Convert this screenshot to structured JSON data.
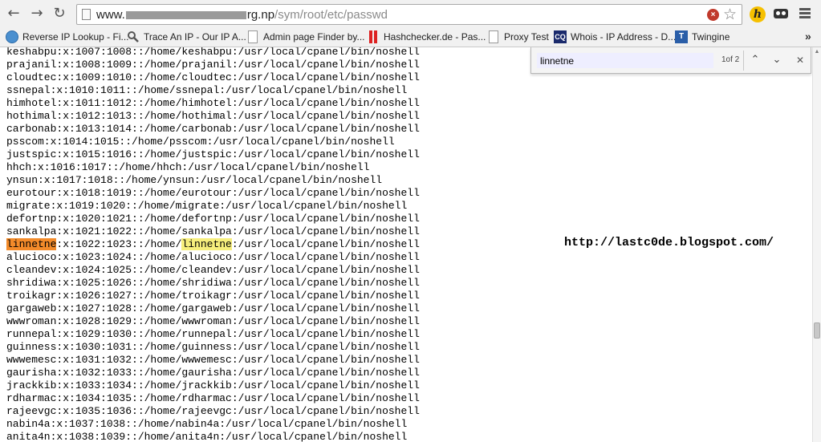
{
  "toolbar": {
    "url_prefix": "www.",
    "url_suffix": "rg.np",
    "url_path": "/sym/root/etc/passwd",
    "back_icon": "back-arrow-icon",
    "forward_icon": "forward-arrow-icon",
    "reload_icon": "reload-icon"
  },
  "bookmarks": [
    {
      "label": "Reverse IP Lookup - Fi...",
      "icon": "globe-icon"
    },
    {
      "label": "Trace An IP - Our IP A...",
      "icon": "magnifier-icon"
    },
    {
      "label": "Admin page Finder by...",
      "icon": "page-icon"
    },
    {
      "label": "Hashchecker.de - Pas...",
      "icon": "bars-icon"
    },
    {
      "label": "Proxy Test",
      "icon": "page-icon"
    },
    {
      "label": "Whois - IP Address - D...",
      "icon": "cq-icon",
      "badge": "CQ"
    },
    {
      "label": "Twingine",
      "icon": "twingine-icon",
      "badge": "T"
    }
  ],
  "bookmarks_more": "»",
  "findbar": {
    "query": "linnetne",
    "count": "1of 2"
  },
  "watermark": "http://lastc0de.blogspot.com/",
  "lines": [
    "keshabpu:x:1007:1008::/home/keshabpu:/usr/local/cpanel/bin/noshell",
    "prajanil:x:1008:1009::/home/prajanil:/usr/local/cpanel/bin/noshell",
    "cloudtec:x:1009:1010::/home/cloudtec:/usr/local/cpanel/bin/noshell",
    "ssnepal:x:1010:1011::/home/ssnepal:/usr/local/cpanel/bin/noshell",
    "himhotel:x:1011:1012::/home/himhotel:/usr/local/cpanel/bin/noshell",
    "hothimal:x:1012:1013::/home/hothimal:/usr/local/cpanel/bin/noshell",
    "carbonab:x:1013:1014::/home/carbonab:/usr/local/cpanel/bin/noshell",
    "psscom:x:1014:1015::/home/psscom:/usr/local/cpanel/bin/noshell",
    "justspic:x:1015:1016::/home/justspic:/usr/local/cpanel/bin/noshell",
    "hhch:x:1016:1017::/home/hhch:/usr/local/cpanel/bin/noshell",
    "ynsun:x:1017:1018::/home/ynsun:/usr/local/cpanel/bin/noshell",
    "eurotour:x:1018:1019::/home/eurotour:/usr/local/cpanel/bin/noshell",
    "migrate:x:1019:1020::/home/migrate:/usr/local/cpanel/bin/noshell",
    "defortnp:x:1020:1021::/home/defortnp:/usr/local/cpanel/bin/noshell",
    "sankalpa:x:1021:1022::/home/sankalpa:/usr/local/cpanel/bin/noshell",
    "linnetne:x:1022:1023::/home/linnetne:/usr/local/cpanel/bin/noshell",
    "alucioco:x:1023:1024::/home/alucioco:/usr/local/cpanel/bin/noshell",
    "cleandev:x:1024:1025::/home/cleandev:/usr/local/cpanel/bin/noshell",
    "shridiwa:x:1025:1026::/home/shridiwa:/usr/local/cpanel/bin/noshell",
    "troikagr:x:1026:1027::/home/troikagr:/usr/local/cpanel/bin/noshell",
    "gargaweb:x:1027:1028::/home/gargaweb:/usr/local/cpanel/bin/noshell",
    "wwwroman:x:1028:1029::/home/wwwroman:/usr/local/cpanel/bin/noshell",
    "runnepal:x:1029:1030::/home/runnepal:/usr/local/cpanel/bin/noshell",
    "guinness:x:1030:1031::/home/guinness:/usr/local/cpanel/bin/noshell",
    "wwwemesc:x:1031:1032::/home/wwwemesc:/usr/local/cpanel/bin/noshell",
    "gaurisha:x:1032:1033::/home/gaurisha:/usr/local/cpanel/bin/noshell",
    "jrackkib:x:1033:1034::/home/jrackkib:/usr/local/cpanel/bin/noshell",
    "rdharmac:x:1034:1035::/home/rdharmac:/usr/local/cpanel/bin/noshell",
    "rajeevgc:x:1035:1036::/home/rajeevgc:/usr/local/cpanel/bin/noshell",
    "nabin4a:x:1037:1038::/home/nabin4a:/usr/local/cpanel/bin/noshell",
    "anita4n:x:1038:1039::/home/anita4n:/usr/local/cpanel/bin/noshell"
  ],
  "colors": {
    "active_match": "#f38b2a",
    "other_match": "#f6ee7c"
  }
}
